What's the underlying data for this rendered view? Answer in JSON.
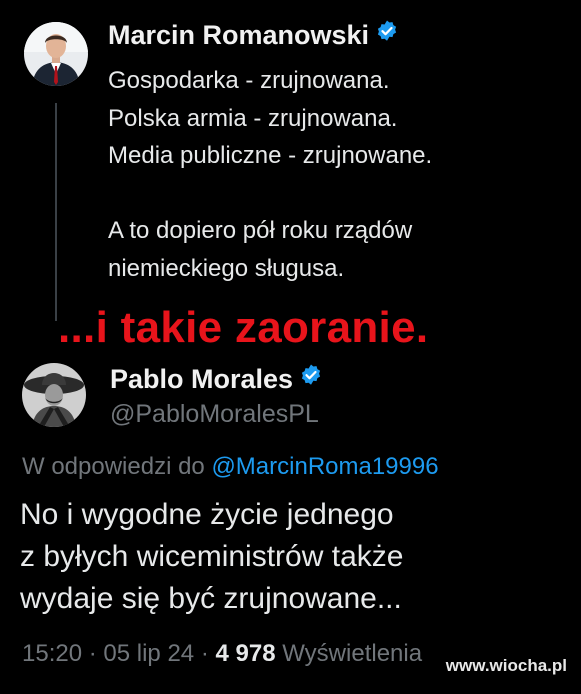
{
  "tweet1": {
    "author_name": "Marcin Romanowski",
    "lines": [
      "Gospodarka - zrujnowana.",
      "Polska armia - zrujnowana.",
      "Media publiczne - zrujnowane.",
      "",
      "A to dopiero pół roku rządów",
      "niemieckiego sługusa."
    ]
  },
  "caption": "...i takie zaoranie.",
  "tweet2": {
    "author_name": "Pablo Morales",
    "handle": "@PabloMoralesPL",
    "reply_prefix": "W odpowiedzi do",
    "reply_mention": "@MarcinRoma19996",
    "lines": [
      "No i wygodne życie jednego",
      "z byłych wiceministrów także",
      "wydaje się być zrujnowane..."
    ],
    "time": "15:20",
    "date": "05 lip 24",
    "views_count": "4 978",
    "views_label": "Wyświetlenia",
    "separator": "·"
  },
  "watermark": "www.wiocha.pl",
  "colors": {
    "background": "#000000",
    "verified": "#1d9bf0",
    "caption": "#e8141b",
    "muted": "#71767b"
  },
  "icons": [
    "verified-badge-icon",
    "verified-badge-icon"
  ]
}
